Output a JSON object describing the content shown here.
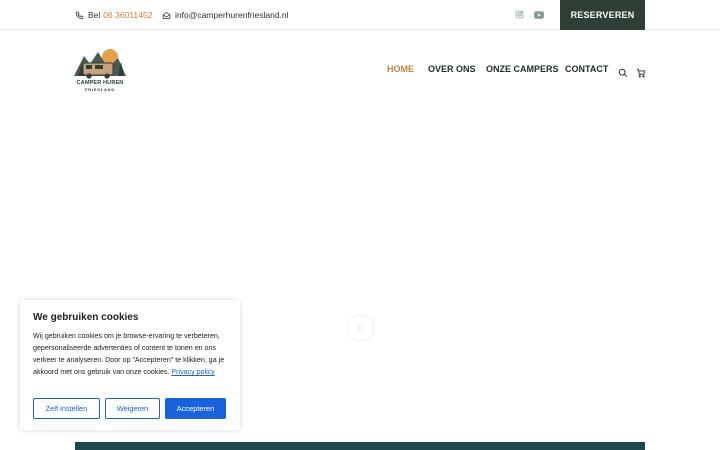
{
  "topbar": {
    "phone_prefix": "Bel",
    "phone_number": "06 36011452",
    "email": "info@camperhurenfriesland.nl",
    "reserve_label": "RESERVEREN",
    "icons": [
      "phone-icon",
      "mail-icon",
      "instagram-icon",
      "youtube-icon"
    ]
  },
  "header": {
    "logo_line1": "CAMPER HUREN",
    "logo_line2": "FRIESLAND",
    "nav": [
      {
        "label": "HOME",
        "active": true
      },
      {
        "label": "OVER ONS",
        "active": false
      },
      {
        "label": "ONZE CAMPERS",
        "active": false
      },
      {
        "label": "CONTACT",
        "active": false
      }
    ],
    "icons": [
      "search-icon",
      "cart-icon"
    ]
  },
  "cookie": {
    "title": "We gebruiken cookies",
    "text": "Wij gebruiken cookies om je browse-ervaring te verbeteren, gepersonaliseerde advertenties of content te tonen en ons verkeer te analyseren. Door op \"Accepteren\" te klikken, ga je akkoord met ons gebruik van onze cookies.",
    "policy_link": "Privacy policy",
    "btn_custom": "Zelf instellen",
    "btn_reject": "Weigeren",
    "btn_accept": "Accepteren"
  },
  "colors": {
    "accent": "#c0843e",
    "dark_green": "#2f3f35",
    "teal": "#1f4a4f",
    "cookie_blue": "#1863dc"
  }
}
